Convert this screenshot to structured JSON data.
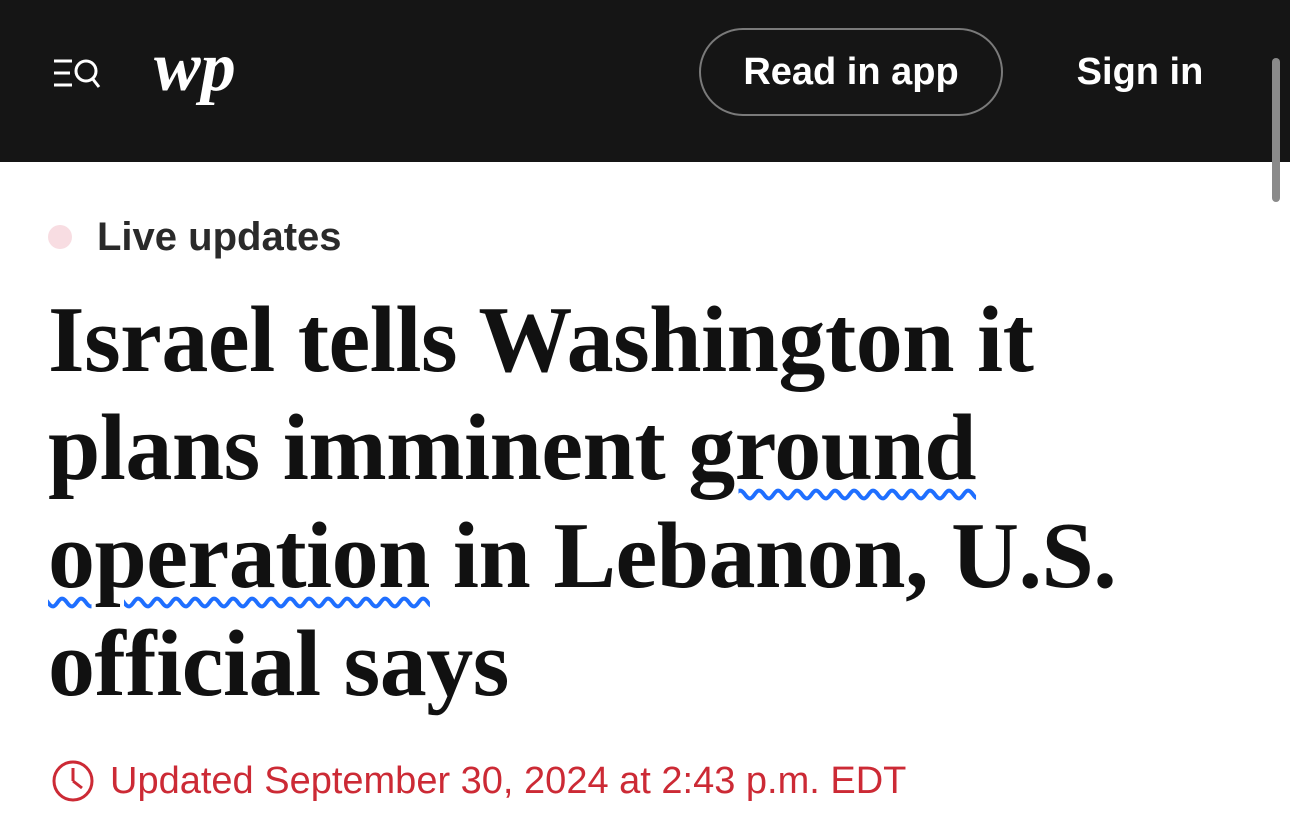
{
  "header": {
    "menu_icon": "menu-search-icon",
    "logo_text": "wp",
    "read_in_app_label": "Read in app",
    "sign_in_label": "Sign in"
  },
  "article": {
    "live_label": "Live updates",
    "headline": {
      "part1": "Israel tells Washington it plans imminent ",
      "highlight1": "ground",
      "part2": " ",
      "highlight2": "operation",
      "part3": " in Lebanon, U.S. official says"
    },
    "updated": "Updated September 30, 2024 at 2:43 p.m. EDT"
  },
  "colors": {
    "header_bg": "#151515",
    "live_dot": "#f8dde2",
    "timestamp": "#cc2a35",
    "squiggle": "#1f6fff"
  }
}
